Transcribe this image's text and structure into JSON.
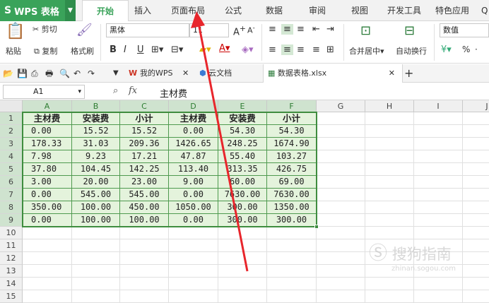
{
  "app": {
    "name": "WPS 表格"
  },
  "menu": [
    "开始",
    "插入",
    "页面布局",
    "公式",
    "数据",
    "审阅",
    "视图",
    "开发工具",
    "特色应用",
    "Q"
  ],
  "ribbon": {
    "paste": "粘贴",
    "cut": "剪切",
    "copy": "复制",
    "format_painter": "格式刷",
    "font_name": "黑体",
    "font_size": "11",
    "bold": "B",
    "italic": "I",
    "underline": "U",
    "font_color_letter": "A",
    "merge_center": "合并居中",
    "wrap_text": "自动换行",
    "number_format": "数值",
    "percent": "%"
  },
  "doc_tabs": [
    {
      "label": "我的WPS"
    },
    {
      "label": "云文档"
    },
    {
      "label": "数据表格.xlsx"
    }
  ],
  "formula": {
    "cell_ref": "A1",
    "fx": "fx",
    "content": "主材费"
  },
  "columns": [
    "A",
    "B",
    "C",
    "D",
    "E",
    "F",
    "G",
    "H",
    "I",
    "J"
  ],
  "rows": [
    "1",
    "2",
    "3",
    "4",
    "5",
    "6",
    "7",
    "8",
    "9",
    "10",
    "11",
    "12",
    "13",
    "14",
    "15"
  ],
  "table": {
    "headers": [
      "主材费",
      "安装费",
      "小计",
      "主材费",
      "安装费",
      "小计"
    ],
    "rows": [
      [
        "0.00",
        "15.52",
        "15.52",
        "0.00",
        "54.30",
        "54.30"
      ],
      [
        "178.33",
        "31.03",
        "209.36",
        "1426.65",
        "248.25",
        "1674.90"
      ],
      [
        "7.98",
        "9.23",
        "17.21",
        "47.87",
        "55.40",
        "103.27"
      ],
      [
        "37.80",
        "104.45",
        "142.25",
        "113.40",
        "313.35",
        "426.75"
      ],
      [
        "3.00",
        "20.00",
        "23.00",
        "9.00",
        "60.00",
        "69.00"
      ],
      [
        "0.00",
        "545.00",
        "545.00",
        "0.00",
        "7630.00",
        "7630.00"
      ],
      [
        "350.00",
        "100.00",
        "450.00",
        "1050.00",
        "300.00",
        "1350.00"
      ],
      [
        "0.00",
        "100.00",
        "100.00",
        "0.00",
        "300.00",
        "300.00"
      ]
    ]
  },
  "watermark": {
    "brand": "搜狗指南",
    "url": "zhinan.sogou.com"
  }
}
